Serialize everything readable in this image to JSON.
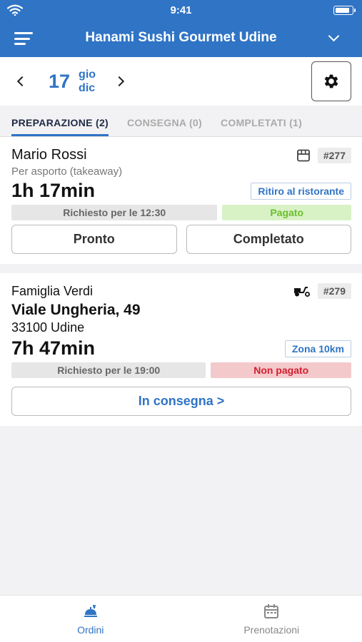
{
  "status": {
    "time": "9:41"
  },
  "header": {
    "title": "Hanami Sushi Gourmet Udine"
  },
  "date": {
    "day": "17",
    "weekday": "gio",
    "month": "dic"
  },
  "tabs": [
    {
      "label": "PREPARAZIONE (2)",
      "active": true
    },
    {
      "label": "CONSEGNA (0)",
      "active": false
    },
    {
      "label": "COMPLETATI (1)",
      "active": false
    }
  ],
  "orders": [
    {
      "name": "Mario Rossi",
      "id": "#277",
      "type_icon": "store-icon",
      "subtitle": "Per asporto (takeaway)",
      "elapsed": "1h 17min",
      "badge": "Ritiro al ristorante",
      "requested": "Richiesto per le 12:30",
      "payment": "Pagato",
      "actions": [
        "Pronto",
        "Completato"
      ]
    },
    {
      "name": "Famiglia Verdi",
      "id": "#279",
      "type_icon": "scooter-icon",
      "address_line1": "Viale Ungheria, 49",
      "address_line2": "33100 Udine",
      "elapsed": "7h 47min",
      "badge": "Zona 10km",
      "requested": "Richiesto per le 19:00",
      "payment": "Non pagato",
      "action": "In consegna >"
    }
  ],
  "bottom_nav": [
    {
      "label": "Ordini",
      "icon": "food-tray-icon",
      "active": true
    },
    {
      "label": "Prenotazioni",
      "icon": "calendar-icon",
      "active": false
    }
  ],
  "colors": {
    "primary": "#2f74c5",
    "paid": "#6bbd2c",
    "unpaid": "#d0202f"
  }
}
